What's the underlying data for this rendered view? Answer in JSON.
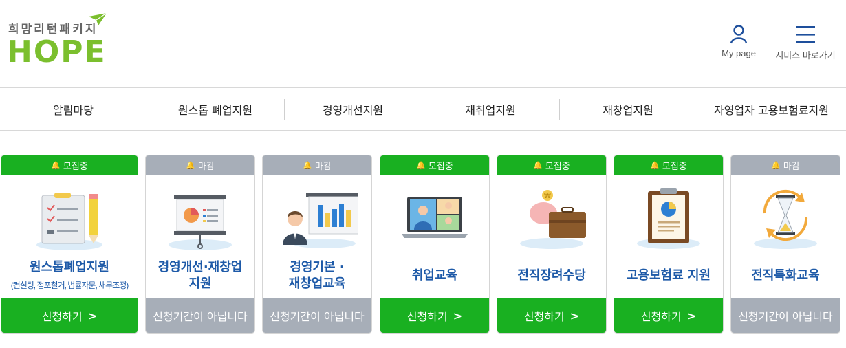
{
  "logo": {
    "subtitle": "희망리턴패키지",
    "wordmark": "HOPE"
  },
  "util": {
    "mypage": "My page",
    "service": "서비스 바로가기"
  },
  "nav": [
    "알림마당",
    "원스톱 폐업지원",
    "경영개선지원",
    "재취업지원",
    "재창업지원",
    "자영업자 고용보험료지원"
  ],
  "colors": {
    "open": "#19b021",
    "closed": "#a7aeb8",
    "title": "#1e5aa8",
    "logo": "#7bbf2e"
  },
  "cards": [
    {
      "status": "모집중",
      "title1": "원스톱폐업지원",
      "title2": "",
      "sub": "(컨설팅, 점포철거, 법률자문, 채무조정)",
      "button": "신청하기",
      "icon": "checklist-pencil-icon"
    },
    {
      "status": "마감",
      "title1": "경영개선·재창업",
      "title2": "지원",
      "sub": "",
      "button": "신청기간이 아닙니다",
      "icon": "presentation-board-icon"
    },
    {
      "status": "마감",
      "title1": "경영기본 ·",
      "title2": "재창업교육",
      "sub": "",
      "button": "신청기간이 아닙니다",
      "icon": "lecturer-chart-icon"
    },
    {
      "status": "모집중",
      "title1": "취업교육",
      "title2": "",
      "sub": "",
      "button": "신청하기",
      "icon": "video-call-laptop-icon"
    },
    {
      "status": "모집중",
      "title1": "전직장려수당",
      "title2": "",
      "sub": "",
      "button": "신청하기",
      "icon": "piggybank-briefcase-icon"
    },
    {
      "status": "모집중",
      "title1": "고용보험료 지원",
      "title2": "",
      "sub": "",
      "button": "신청하기",
      "icon": "clipboard-chart-icon"
    },
    {
      "status": "마감",
      "title1": "전직특화교육",
      "title2": "",
      "sub": "",
      "button": "신청기간이 아닙니다",
      "icon": "hourglass-cycle-icon"
    }
  ]
}
